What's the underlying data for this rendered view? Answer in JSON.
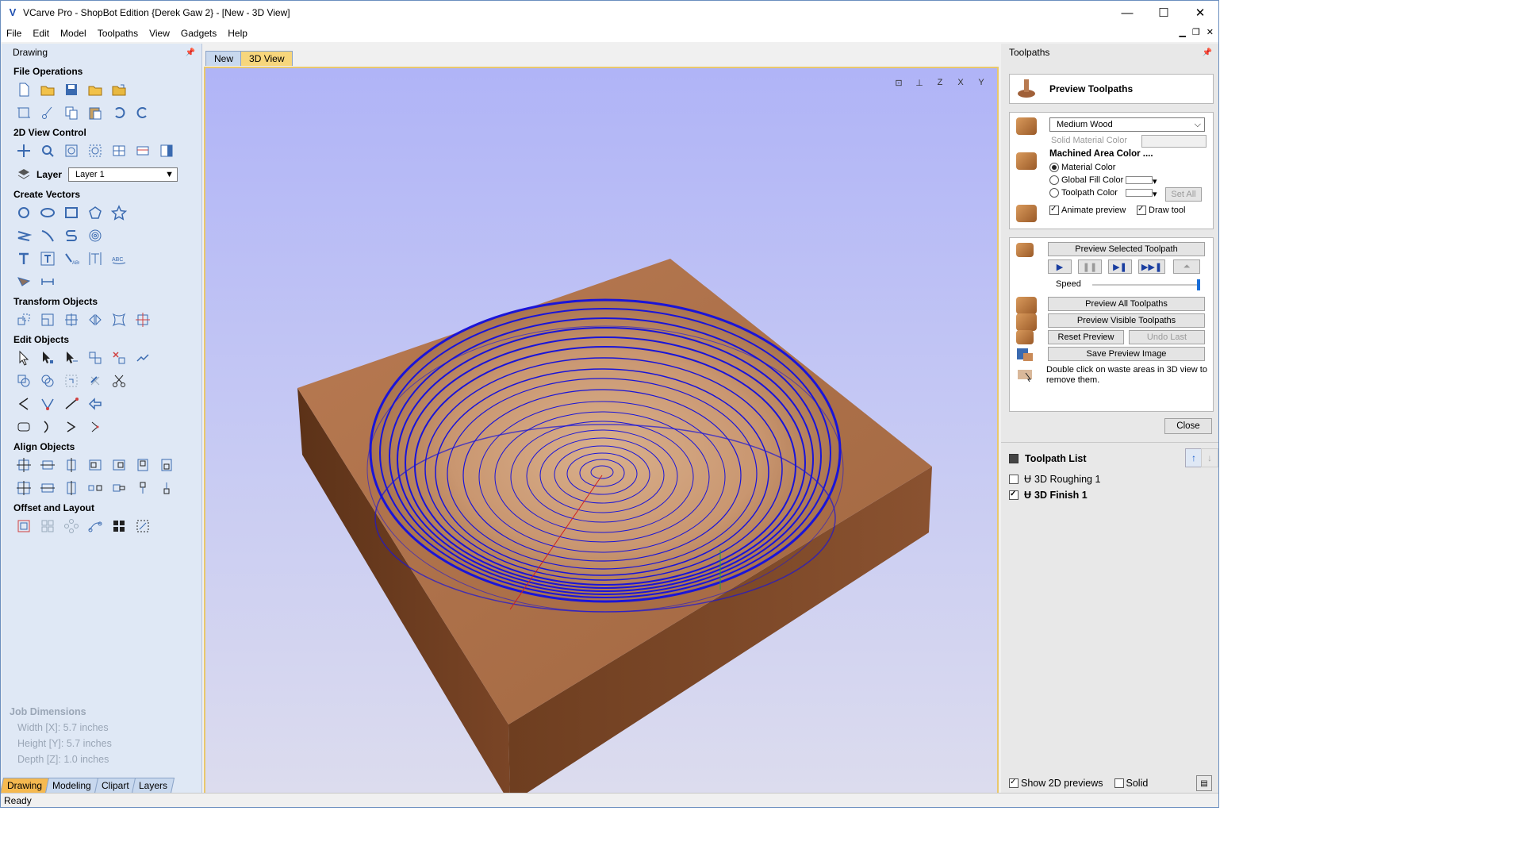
{
  "window": {
    "title": "VCarve Pro - ShopBot Edition {Derek Gaw 2} - [New - 3D View]",
    "controls": [
      "—",
      "☐",
      "✕"
    ]
  },
  "menu": [
    "File",
    "Edit",
    "Model",
    "Toolpaths",
    "View",
    "Gadgets",
    "Help"
  ],
  "left_panel": {
    "title": "Drawing",
    "sections": {
      "file_operations": "File Operations",
      "view_control": "2D View Control",
      "create_vectors": "Create Vectors",
      "transform": "Transform Objects",
      "edit": "Edit Objects",
      "align": "Align Objects",
      "offset": "Offset and Layout"
    },
    "layer_label": "Layer",
    "layer_value": "Layer 1",
    "job_dimensions": {
      "heading": "Job Dimensions",
      "width": "Width  [X]: 5.7 inches",
      "height": "Height [Y]: 5.7 inches",
      "depth": "Depth  [Z]: 1.0 inches"
    },
    "tabs": [
      "Drawing",
      "Modeling",
      "Clipart",
      "Layers"
    ]
  },
  "document_tabs": [
    "New",
    "3D View"
  ],
  "right_panel": {
    "title": "Toolpaths",
    "preview_header": "Preview Toolpaths",
    "material": "Medium Wood",
    "solid_material_color": "Solid Material Color",
    "machined_area_color": "Machined Area Color ....",
    "material_color": "Material Color",
    "global_fill_color": "Global Fill Color",
    "toolpath_color": "Toolpath Color",
    "set_all": "Set All",
    "animate_preview": "Animate preview",
    "draw_tool": "Draw tool",
    "preview_selected": "Preview Selected Toolpath",
    "speed": "Speed",
    "speed_level": 1.0,
    "preview_all": "Preview All Toolpaths",
    "preview_visible": "Preview Visible Toolpaths",
    "reset_preview": "Reset Preview",
    "undo_last": "Undo Last",
    "save_preview_image": "Save Preview Image",
    "hint": "Double click on waste areas in 3D view to remove them.",
    "close": "Close",
    "toolpath_list_title": "Toolpath List",
    "toolpaths": [
      {
        "name": "3D Roughing 1",
        "checked": false
      },
      {
        "name": "3D Finish 1",
        "checked": true
      }
    ],
    "show_2d_previews": "Show 2D previews",
    "solid": "Solid"
  },
  "status": "Ready"
}
